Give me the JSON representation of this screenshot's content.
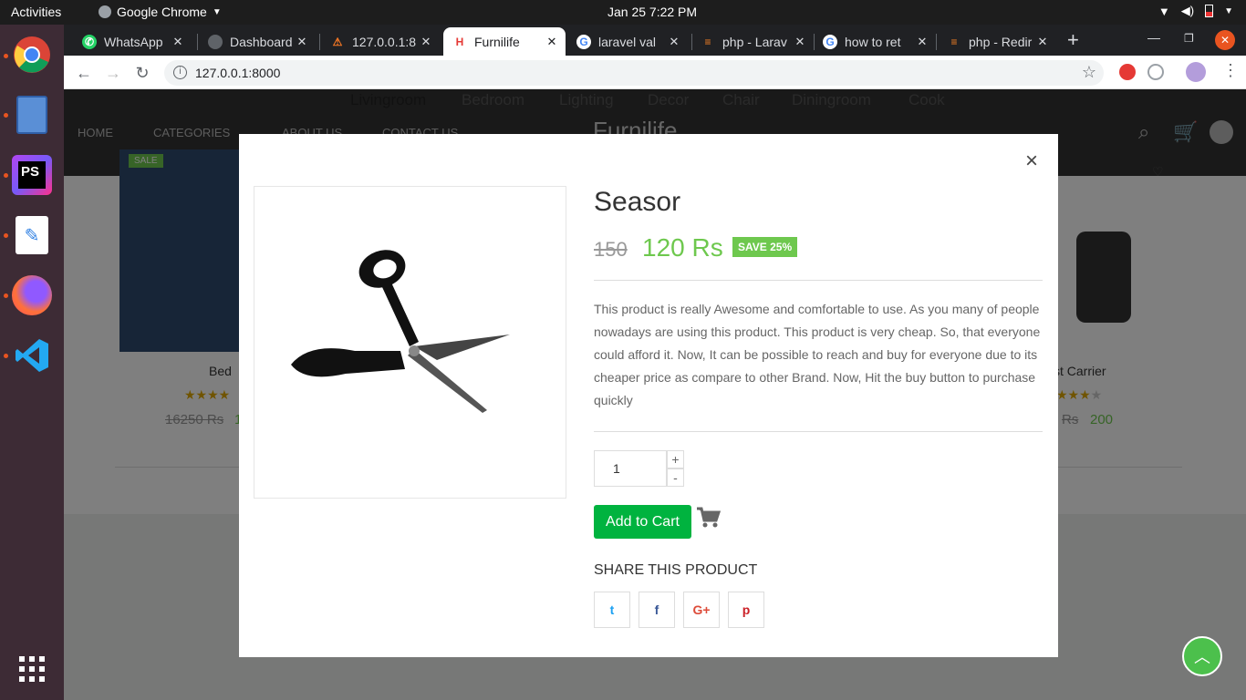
{
  "topbar": {
    "activities": "Activities",
    "app_name": "Google Chrome",
    "clock": "Jan 25  7:22 PM"
  },
  "dock": {
    "items": [
      "chrome-icon",
      "files-icon",
      "phpstorm-icon",
      "text-editor-icon",
      "firefox-icon",
      "vscode-icon",
      "app-grid-icon"
    ]
  },
  "browser": {
    "tabs": [
      {
        "label": "WhatsApp",
        "icon": "whatsapp-icon"
      },
      {
        "label": "Dashboard",
        "icon": "globe-icon"
      },
      {
        "label": "127.0.0.1:8",
        "icon": "xampp-icon"
      },
      {
        "label": "Furnilife",
        "icon": "furnilife-icon"
      },
      {
        "label": "laravel val",
        "icon": "google-icon"
      },
      {
        "label": "php - Larav",
        "icon": "stackoverflow-icon"
      },
      {
        "label": "how to ret",
        "icon": "google-icon"
      },
      {
        "label": "php - Redir",
        "icon": "stackoverflow-icon"
      }
    ],
    "url": "127.0.0.1:8000"
  },
  "site": {
    "categories": [
      "Livingroom",
      "Bedroom",
      "Lighting",
      "Decor",
      "Chair",
      "Diningroom",
      "Cook"
    ],
    "nav": [
      "HOME",
      "CATEGORIES",
      "ABOUT US",
      "CONTACT US"
    ],
    "logo": "Furnilife",
    "bg_products": [
      {
        "name": "Bed",
        "old_price": "16250 Rs",
        "new_price": "1"
      },
      {
        "name": "st Carrier",
        "old_price": "Rs",
        "new_price": "200"
      }
    ],
    "sale_label": "SALE"
  },
  "modal": {
    "title": "Seasor",
    "old_price": "150",
    "new_price": "120 Rs",
    "save_badge": "SAVE 25%",
    "description": "This product is really Awesome and comfortable to use. As you many of people nowadays are using this product. This product is very cheap. So, that everyone could afford it. Now, It can be possible to reach and buy for everyone due to its cheaper price as compare to other Brand. Now, Hit the buy button to purchase quickly",
    "quantity": "1",
    "plus": "+",
    "minus": "-",
    "add_to_cart": "Add to Cart",
    "share_title": "SHARE THIS PRODUCT",
    "share_buttons": [
      {
        "icon": "twitter-icon",
        "glyph": "t"
      },
      {
        "icon": "facebook-icon",
        "glyph": "f"
      },
      {
        "icon": "google-plus-icon",
        "glyph": "G+"
      },
      {
        "icon": "pinterest-icon",
        "glyph": "p"
      }
    ],
    "close": "×"
  },
  "colors": {
    "accent_green": "#6ec84e",
    "cart_button": "#00b33f",
    "header_bg": "#333333"
  }
}
